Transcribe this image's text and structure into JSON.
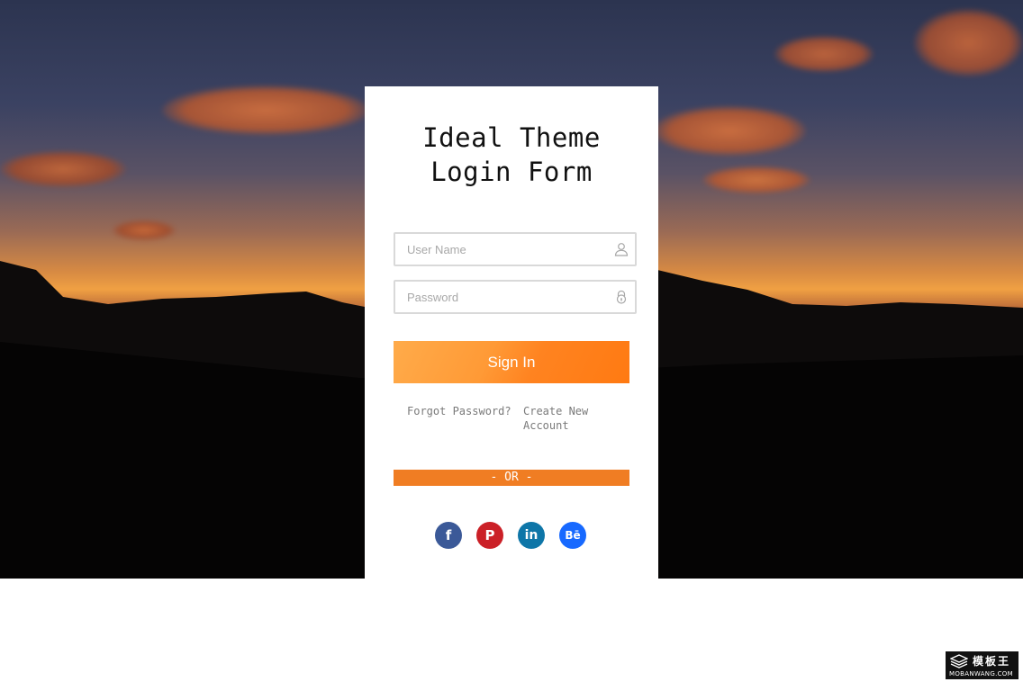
{
  "login": {
    "title_line1": "Ideal Theme",
    "title_line2": "Login Form",
    "username_placeholder": "User Name",
    "password_placeholder": "Password",
    "signin_label": "Sign In",
    "forgot_label": "Forgot Password?",
    "create_label": "Create New Account",
    "or_label": "- OR -",
    "socials": [
      {
        "name": "facebook",
        "glyph": "f",
        "color": "#3b5998"
      },
      {
        "name": "pinterest",
        "glyph": "P",
        "color": "#cb2027"
      },
      {
        "name": "linkedin",
        "glyph": "in",
        "color": "#0e76a8"
      },
      {
        "name": "behance",
        "glyph": "Bē",
        "color": "#1769ff"
      }
    ],
    "accent_color": "#ff8a24"
  },
  "watermark": {
    "cn": "模板王",
    "en": "MOBANWANG.COM"
  },
  "icons": {
    "username": "user-icon",
    "password": "lock-icon"
  }
}
